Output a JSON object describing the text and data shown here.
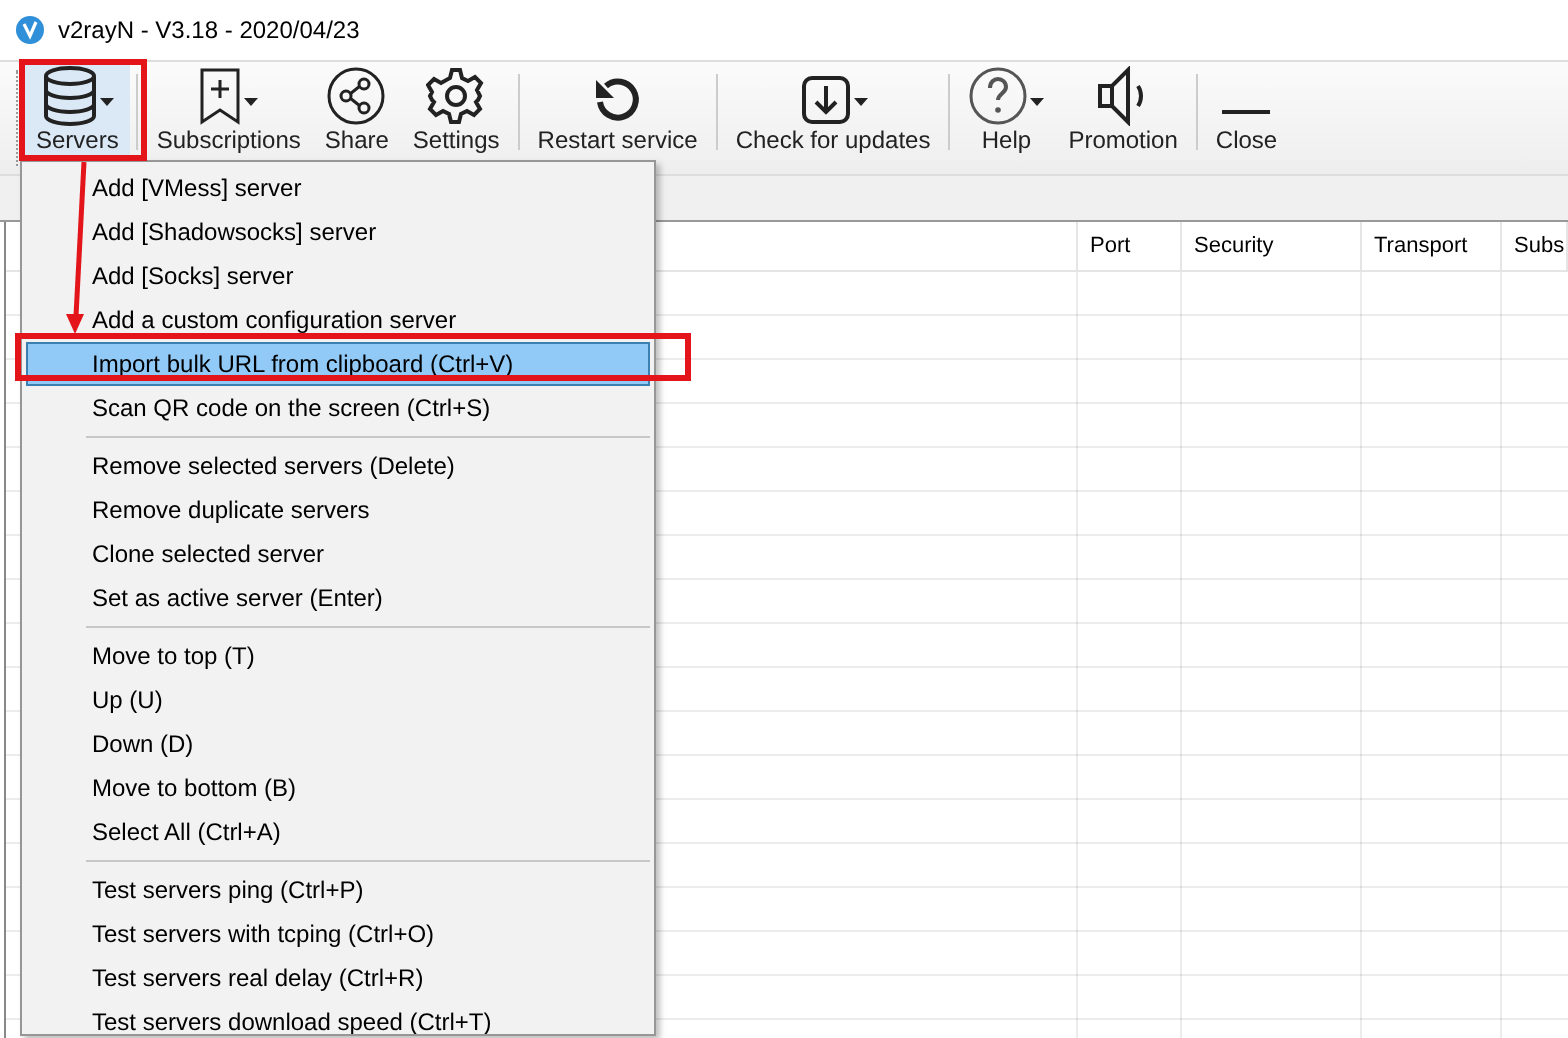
{
  "window": {
    "title": "v2rayN - V3.18 - 2020/04/23"
  },
  "toolbar": [
    {
      "label": "Servers",
      "has_menu": true,
      "pressed": true
    },
    {
      "label": "Subscriptions",
      "has_menu": true,
      "pressed": false
    },
    {
      "label": "Share",
      "has_menu": false,
      "pressed": false
    },
    {
      "label": "Settings",
      "has_menu": false,
      "pressed": false
    },
    {
      "label": "Restart service",
      "has_menu": false,
      "pressed": false
    },
    {
      "label": "Check for updates",
      "has_menu": true,
      "pressed": false
    },
    {
      "label": "Help",
      "has_menu": true,
      "pressed": false
    },
    {
      "label": "Promotion",
      "has_menu": false,
      "pressed": false
    },
    {
      "label": "Close",
      "has_menu": false,
      "pressed": false
    }
  ],
  "table": {
    "columns": [
      "Port",
      "Security",
      "Transport",
      "Subs"
    ]
  },
  "menu": {
    "sections": [
      {
        "items": [
          {
            "label": "Add [VMess] server",
            "selected": false
          },
          {
            "label": "Add [Shadowsocks] server",
            "selected": false
          },
          {
            "label": "Add [Socks] server",
            "selected": false
          },
          {
            "label": "Add a custom configuration server",
            "selected": false
          },
          {
            "label": "Import bulk URL from clipboard (Ctrl+V)",
            "selected": true
          },
          {
            "label": "Scan QR code on the screen (Ctrl+S)",
            "selected": false
          }
        ]
      },
      {
        "items": [
          {
            "label": "Remove selected servers (Delete)",
            "selected": false
          },
          {
            "label": "Remove duplicate servers",
            "selected": false
          },
          {
            "label": "Clone selected server",
            "selected": false
          },
          {
            "label": "Set as active server (Enter)",
            "selected": false
          }
        ]
      },
      {
        "items": [
          {
            "label": "Move to top (T)",
            "selected": false
          },
          {
            "label": "Up (U)",
            "selected": false
          },
          {
            "label": "Down (D)",
            "selected": false
          },
          {
            "label": "Move to bottom (B)",
            "selected": false
          },
          {
            "label": "Select All (Ctrl+A)",
            "selected": false
          }
        ]
      },
      {
        "items": [
          {
            "label": "Test servers ping (Ctrl+P)",
            "selected": false
          },
          {
            "label": "Test servers with tcping (Ctrl+O)",
            "selected": false
          },
          {
            "label": "Test servers real delay (Ctrl+R)",
            "selected": false
          },
          {
            "label": "Test servers download speed (Ctrl+T)",
            "selected": false
          }
        ]
      }
    ]
  }
}
